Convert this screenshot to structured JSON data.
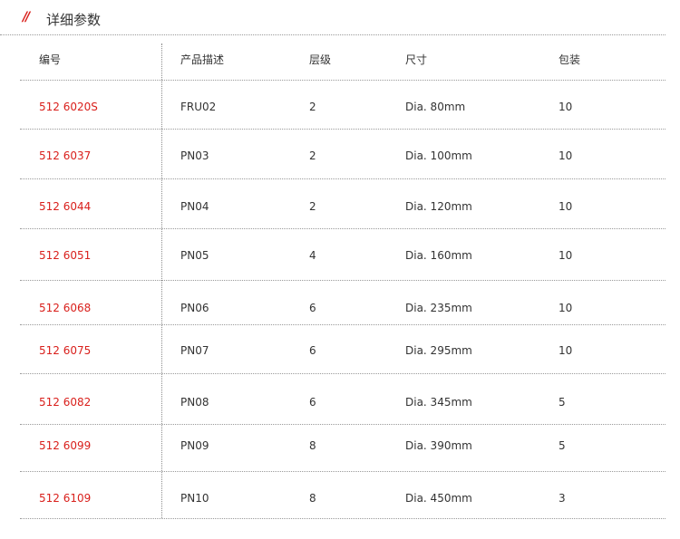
{
  "section": {
    "marker": "//",
    "title": "详细参数"
  },
  "table": {
    "headers": [
      "编号",
      "产品描述",
      "层级",
      "尺寸",
      "包装"
    ],
    "rows": [
      [
        "512 6020S",
        "FRU02",
        "2",
        "Dia. 80mm",
        "10"
      ],
      [
        "512 6037",
        "PN03",
        "2",
        "Dia. 100mm",
        "10"
      ],
      [
        "512 6044",
        "PN04",
        "2",
        "Dia. 120mm",
        "10"
      ],
      [
        "512 6051",
        "PN05",
        "4",
        "Dia. 160mm",
        "10"
      ],
      [
        "512 6068",
        "PN06",
        "6",
        "Dia. 235mm",
        "10"
      ],
      [
        "512 6075",
        "PN07",
        "6",
        "Dia. 295mm",
        "10"
      ],
      [
        "512 6082",
        "PN08",
        "6",
        "Dia. 345mm",
        "5"
      ],
      [
        "512 6099",
        "PN09",
        "8",
        "Dia. 390mm",
        "5"
      ],
      [
        "512 6109",
        "PN10",
        "8",
        "Dia. 450mm",
        "3"
      ]
    ]
  },
  "colors": {
    "accent": "#d9201c",
    "text": "#333333",
    "divider": "#9a9a9a"
  }
}
